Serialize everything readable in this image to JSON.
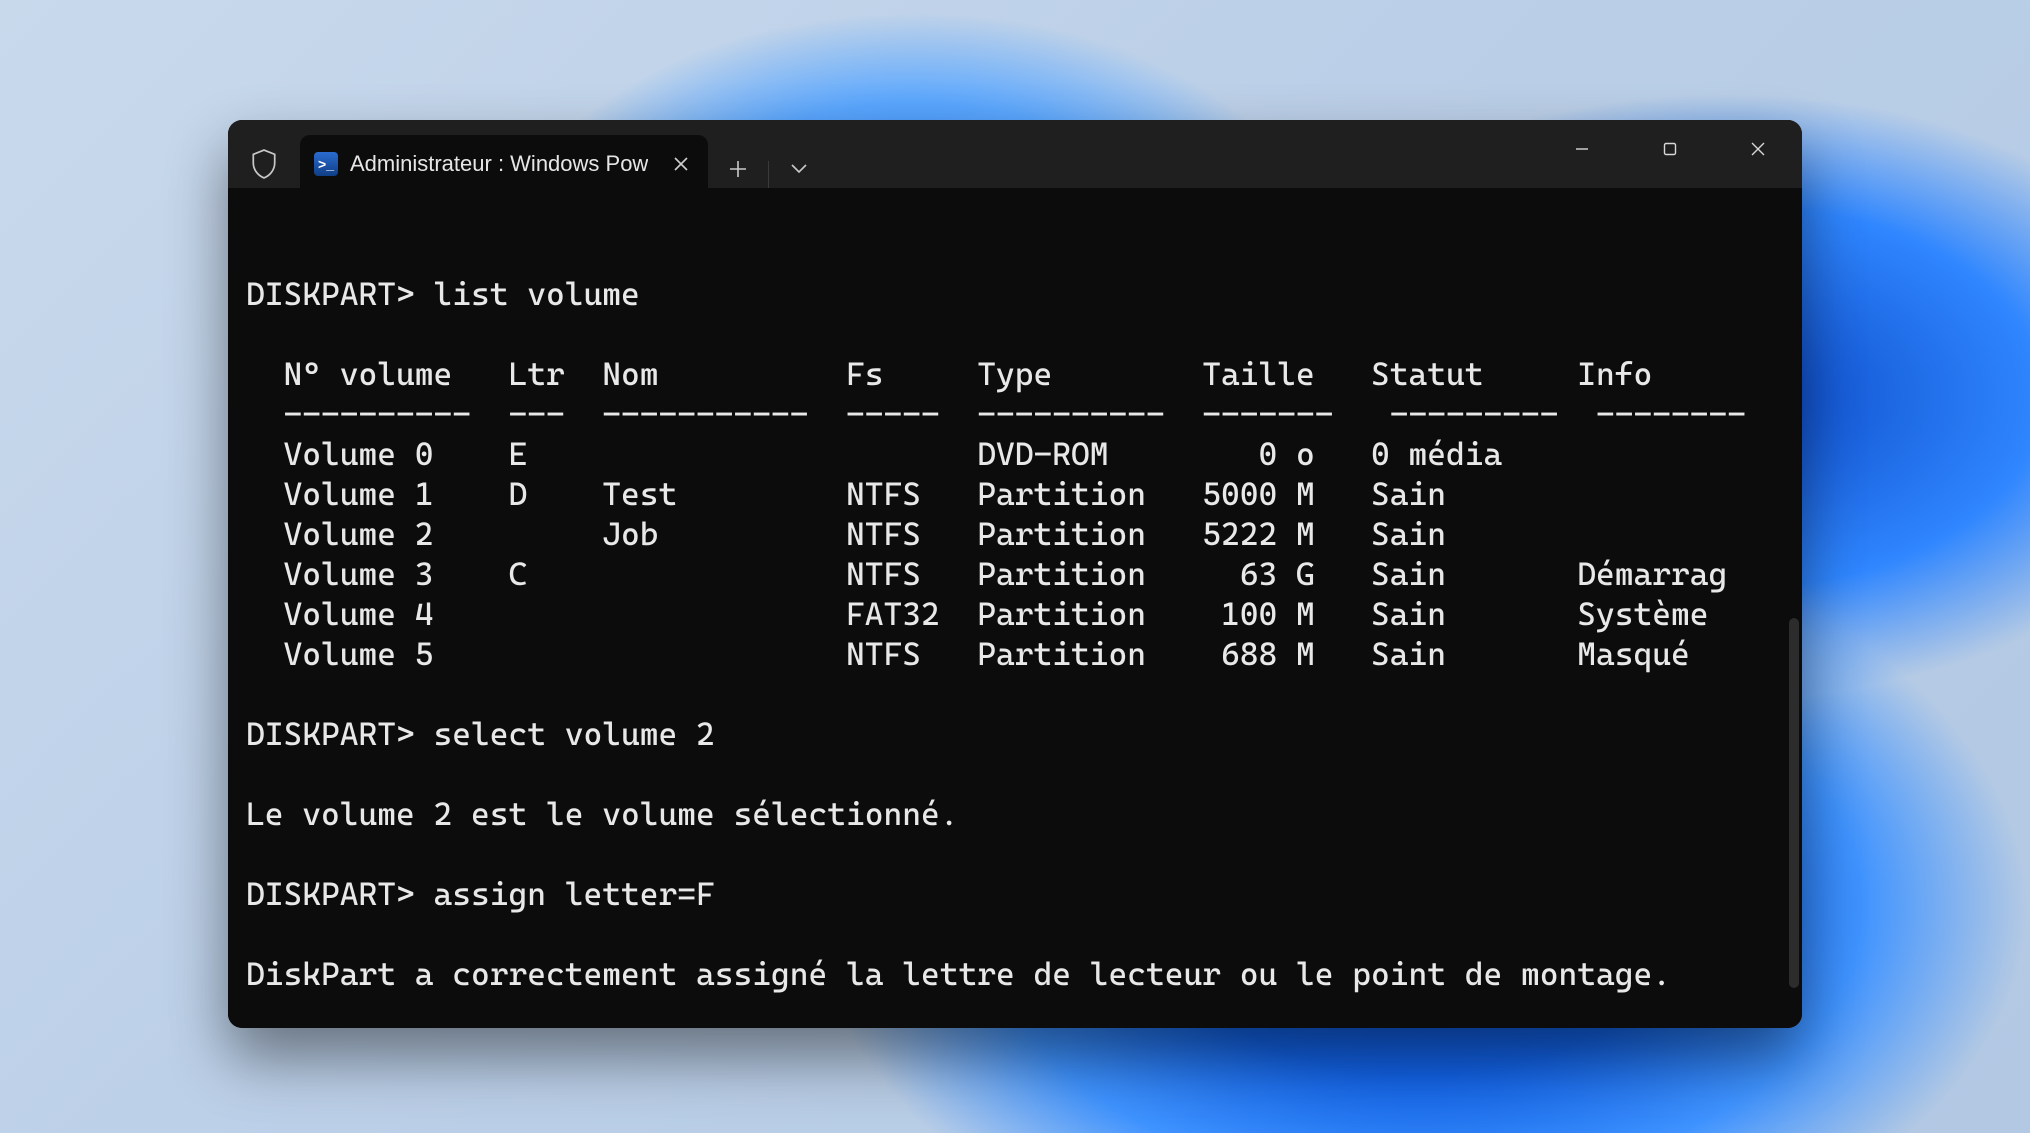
{
  "window": {
    "tab_title": "Administrateur : Windows Pow",
    "icons": {
      "shield": "shield-icon",
      "powershell": "powershell-icon",
      "close_tab": "close-icon",
      "new_tab": "plus-icon",
      "dropdown": "chevron-down-icon",
      "minimize": "minimize-icon",
      "maximize": "maximize-icon",
      "window_close": "close-icon"
    }
  },
  "terminal": {
    "prompt": "DISKPART>",
    "lines": [
      {
        "t": "prompt",
        "cmd": "list volume"
      },
      {
        "t": "blank"
      },
      {
        "t": "header",
        "cols": [
          "N° volume",
          "Ltr",
          "Nom",
          "Fs",
          "Type",
          "Taille",
          "Statut",
          "Info"
        ]
      },
      {
        "t": "divider",
        "cols": [
          "----------",
          "---",
          "-----------",
          "-----",
          "----------",
          "-------",
          "---------",
          "--------"
        ]
      },
      {
        "t": "row",
        "cols": [
          "Volume 0",
          "E",
          "",
          "",
          "DVD-ROM",
          "0 o",
          "0 média",
          ""
        ]
      },
      {
        "t": "row",
        "cols": [
          "Volume 1",
          "D",
          "Test",
          "NTFS",
          "Partition",
          "5000 M",
          "Sain",
          ""
        ]
      },
      {
        "t": "row",
        "cols": [
          "Volume 2",
          "",
          "Job",
          "NTFS",
          "Partition",
          "5222 M",
          "Sain",
          ""
        ]
      },
      {
        "t": "row",
        "cols": [
          "Volume 3",
          "C",
          "",
          "NTFS",
          "Partition",
          "63 G",
          "Sain",
          "Démarrag"
        ]
      },
      {
        "t": "row",
        "cols": [
          "Volume 4",
          "",
          "",
          "FAT32",
          "Partition",
          "100 M",
          "Sain",
          "Système"
        ]
      },
      {
        "t": "row",
        "cols": [
          "Volume 5",
          "",
          "",
          "NTFS",
          "Partition",
          "688 M",
          "Sain",
          "Masqué"
        ]
      },
      {
        "t": "blank"
      },
      {
        "t": "prompt",
        "cmd": "select volume 2"
      },
      {
        "t": "blank"
      },
      {
        "t": "text",
        "txt": "Le volume 2 est le volume sélectionné."
      },
      {
        "t": "blank"
      },
      {
        "t": "prompt",
        "cmd": "assign letter=F"
      },
      {
        "t": "blank"
      },
      {
        "t": "text",
        "txt": "DiskPart a correctement assigné la lettre de lecteur ou le point de montage."
      },
      {
        "t": "blank"
      },
      {
        "t": "prompt_empty"
      }
    ]
  },
  "column_pads": {
    "c0": 10,
    "c1": 5,
    "c2": 13,
    "c3": 7,
    "c4": 12,
    "c5": 8,
    "c6": 11,
    "c7": 8
  }
}
